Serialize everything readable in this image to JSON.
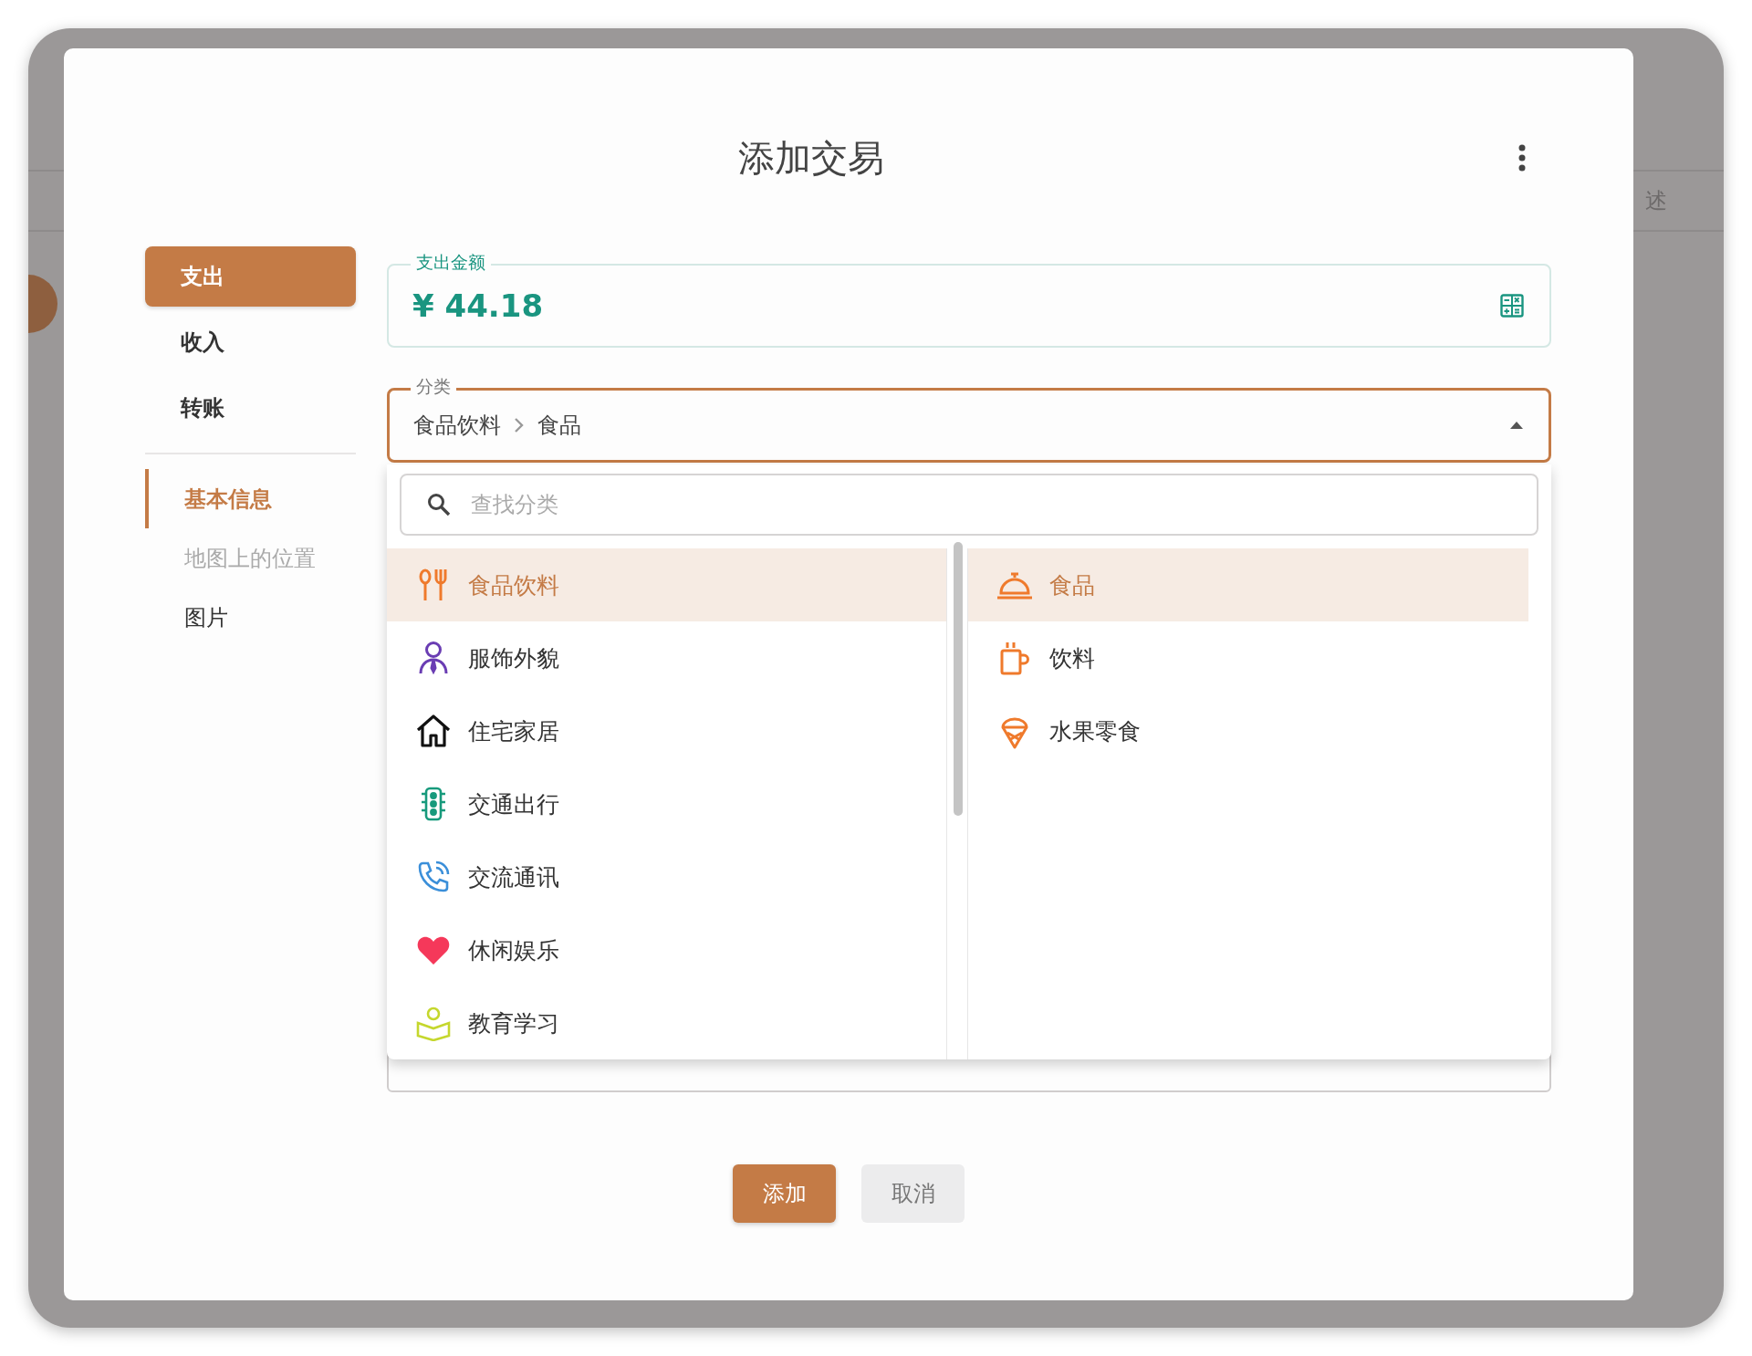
{
  "window": {
    "title": "添加交易"
  },
  "background": {
    "field_label": "述"
  },
  "type_tabs": [
    {
      "label": "支出",
      "selected": true
    },
    {
      "label": "收入",
      "selected": false
    },
    {
      "label": "转账",
      "selected": false
    }
  ],
  "sections": [
    {
      "label": "基本信息",
      "selected": true,
      "disabled": false
    },
    {
      "label": "地图上的位置",
      "selected": false,
      "disabled": true
    },
    {
      "label": "图片",
      "selected": false,
      "disabled": false
    }
  ],
  "amount_field": {
    "label": "支出金额",
    "currency": "¥",
    "value": "44.18"
  },
  "category_field": {
    "label": "分类",
    "path": [
      "食品饮料",
      "食品"
    ],
    "expanded": true
  },
  "category_search": {
    "placeholder": "查找分类"
  },
  "primary_categories": [
    {
      "label": "食品饮料",
      "color": "#ef7a2c",
      "selected": true
    },
    {
      "label": "服饰外貌",
      "color": "#6a3db3",
      "selected": false
    },
    {
      "label": "住宅家居",
      "color": "#111111",
      "selected": false
    },
    {
      "label": "交通出行",
      "color": "#179a7c",
      "selected": false
    },
    {
      "label": "交流通讯",
      "color": "#3b8fd9",
      "selected": false
    },
    {
      "label": "休闲娱乐",
      "color": "#f5385a",
      "selected": false
    },
    {
      "label": "教育学习",
      "color": "#c5d72d",
      "selected": false
    }
  ],
  "sub_categories": [
    {
      "label": "食品",
      "selected": true
    },
    {
      "label": "饮料",
      "selected": false
    },
    {
      "label": "水果零食",
      "selected": false
    }
  ],
  "buttons": [
    {
      "label": "添加",
      "kind": "primary"
    },
    {
      "label": "取消",
      "kind": "secondary"
    }
  ]
}
